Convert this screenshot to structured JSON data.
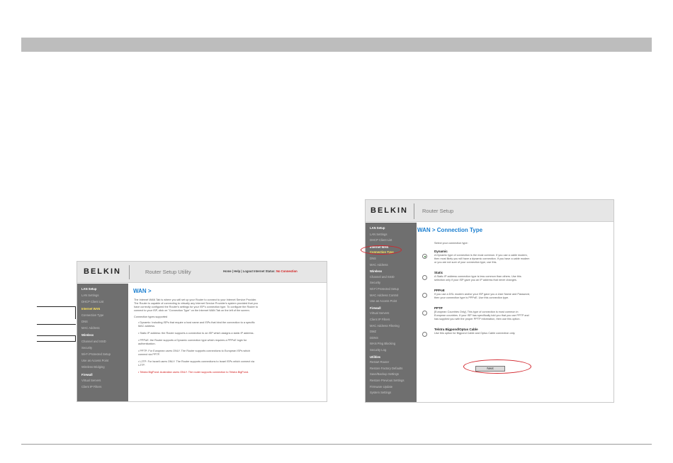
{
  "shot1": {
    "logo": "BELKIN",
    "utility_title": "Router Setup Utility",
    "top_links": {
      "text": "Home | Help | Logout   Internet Status:",
      "status": "No Connection"
    },
    "sidebar": [
      {
        "label": "LAN Setup",
        "kind": "cat"
      },
      {
        "label": "LAN Settings",
        "kind": "item"
      },
      {
        "label": "DHCP Client List",
        "kind": "item"
      },
      {
        "label": "Internet WAN",
        "kind": "sel"
      },
      {
        "label": "Connection Type",
        "kind": "item"
      },
      {
        "label": "DNS",
        "kind": "item"
      },
      {
        "label": "MAC Address",
        "kind": "item"
      },
      {
        "label": "Wireless",
        "kind": "cat"
      },
      {
        "label": "Channel and SSID",
        "kind": "item"
      },
      {
        "label": "Security",
        "kind": "item"
      },
      {
        "label": "Wi-Fi Protected Setup",
        "kind": "item"
      },
      {
        "label": "Use as Access Point",
        "kind": "item"
      },
      {
        "label": "Wireless Bridging",
        "kind": "item"
      },
      {
        "label": "Firewall",
        "kind": "cat"
      },
      {
        "label": "Virtual Servers",
        "kind": "item"
      },
      {
        "label": "Client IP Filters",
        "kind": "item"
      }
    ],
    "page_title": "WAN >",
    "paragraph": [
      "The Internet WAN Tab is where you will set up your Router to connect to your Internet Service Provider.",
      "The Router is capable of connecting to virtually any Internet Service Provider's system provided that you",
      "have correctly configured the Router's settings for your ISP's connection type. To configure the Router to",
      "connect to your ISP, click on \"Connection Type\" on the Internet WAN Tab on the left of the screen."
    ],
    "types_heading": "Connection types supported",
    "bullets": [
      {
        "lines": [
          "Dynamic: Including ISPs that require a host name and ISPs that bind the connection to a specific",
          "MAC address."
        ],
        "red": false
      },
      {
        "lines": [
          "Static IP address: the Router supports a connection to an ISP which assigns a static IP address."
        ],
        "red": false
      },
      {
        "lines": [
          "PPPoE: the Router supports a Dynamic connection type which requires a PPPoE login for",
          "authentication."
        ],
        "red": false
      },
      {
        "lines": [
          "PPTP: For European users ONLY. The Router supports connections to European ISPs which",
          "connect via PPTP."
        ],
        "red": false
      },
      {
        "lines": [
          "L2TP: For Israeli users ONLY. The Router supports connections to Israel ISPs which connect via",
          "L2TP."
        ],
        "red": false
      },
      {
        "lines": [
          "Telstra BigPond: Australian users ONLY. The router supports connection to Telstra BigPond."
        ],
        "red": true
      }
    ]
  },
  "shot2": {
    "logo": "BELKIN",
    "utility_title": "Router Setup",
    "sidebar": [
      {
        "label": "LAN Setup",
        "kind": "cat"
      },
      {
        "label": "LAN Settings",
        "kind": "item"
      },
      {
        "label": "DHCP Client List",
        "kind": "item"
      },
      {
        "label": "Internet WAN",
        "kind": "cat"
      },
      {
        "label": "Connection Type",
        "kind": "sel"
      },
      {
        "label": "DNS",
        "kind": "item"
      },
      {
        "label": "MAC Address",
        "kind": "item"
      },
      {
        "label": "Wireless",
        "kind": "cat"
      },
      {
        "label": "Channel and SSID",
        "kind": "item"
      },
      {
        "label": "Security",
        "kind": "item"
      },
      {
        "label": "Wi-Fi Protected Setup",
        "kind": "item"
      },
      {
        "label": "MAC Address Control",
        "kind": "item"
      },
      {
        "label": "Use as Access Point",
        "kind": "item"
      },
      {
        "label": "Firewall",
        "kind": "cat"
      },
      {
        "label": "Virtual Servers",
        "kind": "item"
      },
      {
        "label": "Client IP Filters",
        "kind": "item"
      },
      {
        "label": "MAC Address Filtering",
        "kind": "item"
      },
      {
        "label": "DMZ",
        "kind": "item"
      },
      {
        "label": "DDNS",
        "kind": "item"
      },
      {
        "label": "WAN Ping Blocking",
        "kind": "item"
      },
      {
        "label": "Security Log",
        "kind": "item"
      },
      {
        "label": "Utilities",
        "kind": "cat"
      },
      {
        "label": "Restart Router",
        "kind": "item"
      },
      {
        "label": "Restore Factory Defaults",
        "kind": "item"
      },
      {
        "label": "Save/Backup Settings",
        "kind": "item"
      },
      {
        "label": "Restore Previous Settings",
        "kind": "item"
      },
      {
        "label": "Firmware Update",
        "kind": "item"
      },
      {
        "label": "System Settings",
        "kind": "item"
      }
    ],
    "page_title": "WAN > Connection Type",
    "prompt": "Select your connection type:",
    "options": [
      {
        "name": "Dynamic",
        "selected": true,
        "lines": [
          "A Dynamic type of connection is the most common. If you use a cable modem,",
          "then most likely you will have a dynamic connection. If you have a cable modem",
          "or you are not sure of your connection type, use this."
        ]
      },
      {
        "name": "Static",
        "selected": false,
        "lines": [
          "A Static IP address connection type is less common than others. Use this",
          "selection only if your ISP gave you an IP address that never changes."
        ]
      },
      {
        "name": "PPPoE",
        "selected": false,
        "lines": [
          "If you use a DSL modem and/or your ISP gave you a User Name and Password,",
          "then your connection type is PPPoE. Use this connection type."
        ]
      },
      {
        "name": "PPTP",
        "selected": false,
        "lines": [
          "[European Countries Only]. This type of connection is most common in",
          "European countries. If your ISP has specifically told you that you use PPTP and",
          "has supplied you with the proper PPTP information, then use this option."
        ]
      },
      {
        "name": "Telstra Bigpond/Optus Cable",
        "selected": false,
        "lines": [
          "Use this option for Bigpond Cable and Optus Cable connection only."
        ]
      }
    ],
    "next_label": "Next"
  },
  "accent_colors": {
    "annotation": "#d2232a",
    "sidebar": "#6f6f6f",
    "title": "#1c7fd0"
  }
}
